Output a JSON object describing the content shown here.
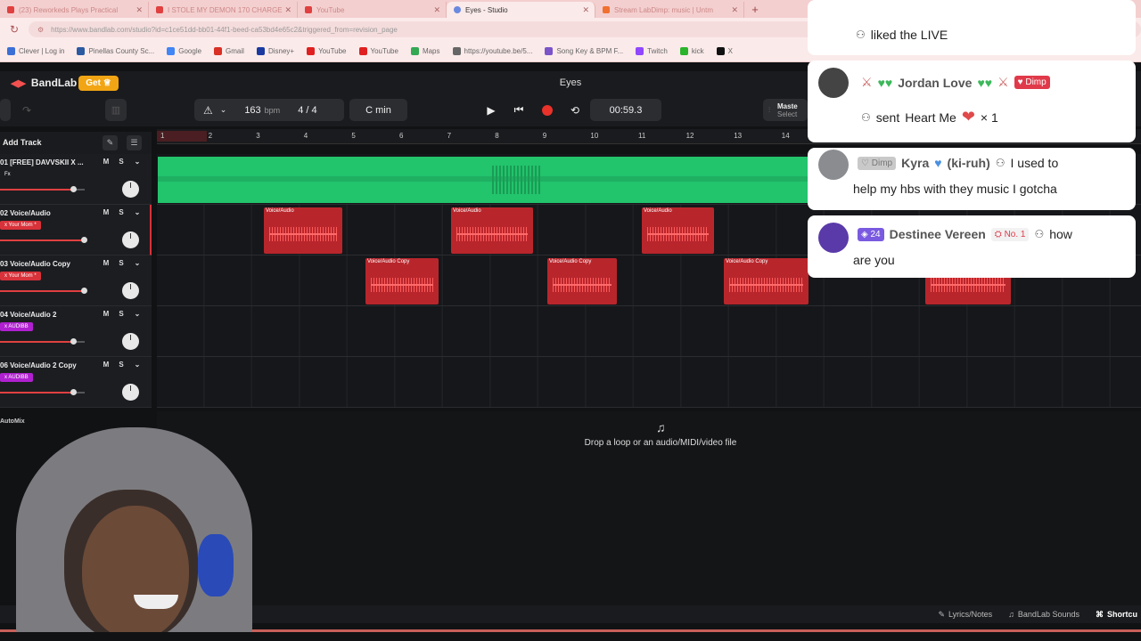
{
  "browser": {
    "tabs": [
      {
        "title": "(23) Reworkeds Plays Practical"
      },
      {
        "title": "I STOLE MY DEMON 170 CHARGE"
      },
      {
        "title": "YouTube"
      },
      {
        "title": "Eyes - Studio"
      },
      {
        "title": "Stream LabDimp: music | Untm"
      }
    ],
    "active_tab": 3,
    "url": "https://www.bandlab.com/studio?id=c1ce51dd-bb01-44f1-beed-ca53bd4e65c2&triggered_from=revision_page",
    "bookmarks": [
      {
        "label": "Clever | Log in",
        "color": "#3b6fd6"
      },
      {
        "label": "Pinellas County Sc...",
        "color": "#2c5aa0"
      },
      {
        "label": "Google",
        "color": "#4285f4"
      },
      {
        "label": "Gmail",
        "color": "#d93025"
      },
      {
        "label": "Disney+",
        "color": "#1a3aa0"
      },
      {
        "label": "YouTube",
        "color": "#e02020"
      },
      {
        "label": "YouTube",
        "color": "#e02020"
      },
      {
        "label": "Maps",
        "color": "#34a853"
      },
      {
        "label": "https://youtube.be/5...",
        "color": "#666666"
      },
      {
        "label": "Song Key & BPM F...",
        "color": "#7a54c8"
      },
      {
        "label": "Twitch",
        "color": "#9146ff"
      },
      {
        "label": "kick",
        "color": "#2bb32b"
      },
      {
        "label": "X",
        "color": "#111111"
      }
    ]
  },
  "app": {
    "brand": "BandLab",
    "get_label": "Get",
    "project_title": "Eyes",
    "bpm": "163",
    "bpm_unit": "bpm",
    "time_signature": "4 / 4",
    "key": "C min",
    "time": "00:59.3",
    "master_label": "Maste",
    "master_sub": "Select",
    "add_track": "Add Track",
    "automix": "AutoMix",
    "drop_hint": "Drop a loop or an audio/MIDI/video file",
    "ruler": [
      "1",
      "2",
      "3",
      "4",
      "5",
      "6",
      "7",
      "8",
      "9",
      "10",
      "11",
      "12",
      "13",
      "14"
    ],
    "tracks": [
      {
        "name": "01  [FREE] DAVVSKII X ...",
        "fx": "Fx",
        "fx_color": "#1c1d21",
        "volume": 0.87
      },
      {
        "name": "02  Voice/Audio",
        "fx": "x Your Mom *",
        "fx_color": "#d8323a",
        "volume": 1.0
      },
      {
        "name": "03  Voice/Audio Copy",
        "fx": "x Your Mom *",
        "fx_color": "#d8323a",
        "volume": 1.0
      },
      {
        "name": "04  Voice/Audio 2",
        "fx": "x AUDIBB",
        "fx_color": "#b020d0",
        "volume": 0.87
      },
      {
        "name": "06  Voice/Audio 2 Copy",
        "fx": "x AUDIBB",
        "fx_color": "#b020d0",
        "volume": 0.87
      }
    ],
    "clip_label_voice": "Voice/Audio",
    "clip_label_copy": "Voice/Audio Copy",
    "bottom": {
      "lyrics": "Lyrics/Notes",
      "sounds": "BandLab Sounds",
      "shortcuts": "Shortcu"
    }
  },
  "chat": {
    "msg1": {
      "text": "liked the LIVE"
    },
    "msg2": {
      "name": "Jordan Love",
      "badge": "Dimp",
      "action": "sent",
      "gift": "Heart Me",
      "count": "× 1"
    },
    "msg3": {
      "badge": "Dimp",
      "name": "Kyra",
      "name_suffix": "(ki-ruh)",
      "text1": "I used to",
      "text2": "help my hbs with they music I gotcha"
    },
    "msg4": {
      "level": "24",
      "name": "Destinee Vereen",
      "rank": "No. 1",
      "text1": "how",
      "text2": "are you"
    }
  }
}
